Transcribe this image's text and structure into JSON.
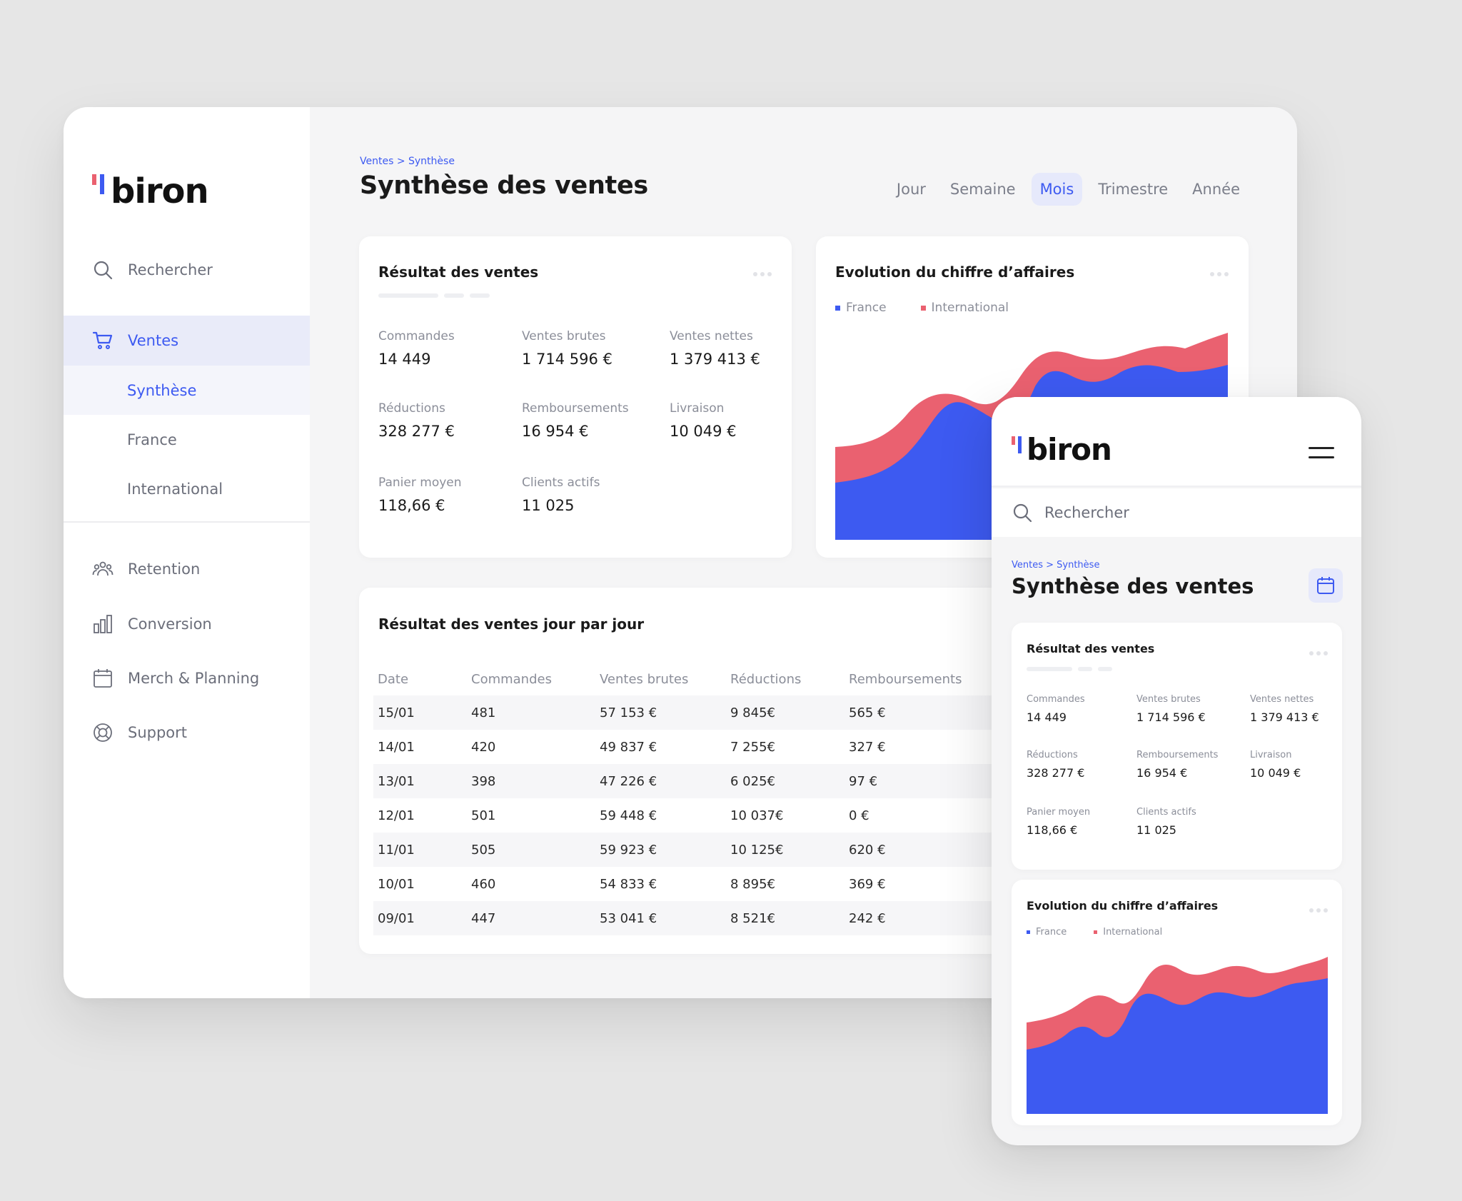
{
  "brand": {
    "name": "biron",
    "red": "#ea6170",
    "blue": "#3d5af1"
  },
  "sidebar": {
    "search_label": "Rechercher",
    "main_item": "Ventes",
    "sub_items": [
      "Synthèse",
      "France",
      "International"
    ],
    "items": [
      {
        "label": "Retention",
        "icon": "users-icon"
      },
      {
        "label": "Conversion",
        "icon": "bar-chart-icon"
      },
      {
        "label": "Merch & Planning",
        "icon": "calendar-icon"
      },
      {
        "label": "Support",
        "icon": "lifebuoy-icon"
      }
    ]
  },
  "header": {
    "breadcrumb": "Ventes > Synthèse",
    "title": "Synthèse des ventes",
    "periods": [
      "Jour",
      "Semaine",
      "Mois",
      "Trimestre",
      "Année"
    ],
    "active_period": "Mois"
  },
  "summary": {
    "title": "Résultat des ventes",
    "metrics": [
      {
        "label": "Commandes",
        "value": "14 449"
      },
      {
        "label": "Ventes brutes",
        "value": "1 714 596 €"
      },
      {
        "label": "Ventes nettes",
        "value": "1 379 413 €"
      },
      {
        "label": "Réductions",
        "value": "328 277 €"
      },
      {
        "label": "Remboursements",
        "value": "16 954 €"
      },
      {
        "label": "Livraison",
        "value": "10 049 €"
      },
      {
        "label": "Panier moyen",
        "value": "118,66 €"
      },
      {
        "label": "Clients actifs",
        "value": "11 025"
      }
    ]
  },
  "revenue_chart": {
    "title": "Evolution du chiffre d’affaires",
    "legend": [
      "France",
      "International"
    ]
  },
  "daily_table": {
    "title": "Résultat des ventes jour par jour",
    "columns": [
      "Date",
      "Commandes",
      "Ventes brutes",
      "Réductions",
      "Remboursements"
    ],
    "rows": [
      [
        "15/01",
        "481",
        "57 153 €",
        "9 845€",
        "565 €"
      ],
      [
        "14/01",
        "420",
        "49 837 €",
        "7 255€",
        "327 €"
      ],
      [
        "13/01",
        "398",
        "47 226 €",
        "6 025€",
        "97 €"
      ],
      [
        "12/01",
        "501",
        "59 448 €",
        "10 037€",
        "0 €"
      ],
      [
        "11/01",
        "505",
        "59 923 €",
        "10 125€",
        "620 €"
      ],
      [
        "10/01",
        "460",
        "54 833 €",
        "8 895€",
        "369 €"
      ],
      [
        "09/01",
        "447",
        "53 041 €",
        "8 521€",
        "242 €"
      ]
    ]
  },
  "mobile": {
    "search_label": "Rechercher",
    "breadcrumb": "Ventes > Synthèse",
    "title": "Synthèse des ventes",
    "summary_title": "Résultat des ventes",
    "chart_title": "Evolution du chiffre d’affaires",
    "legend": [
      "France",
      "International"
    ]
  }
}
